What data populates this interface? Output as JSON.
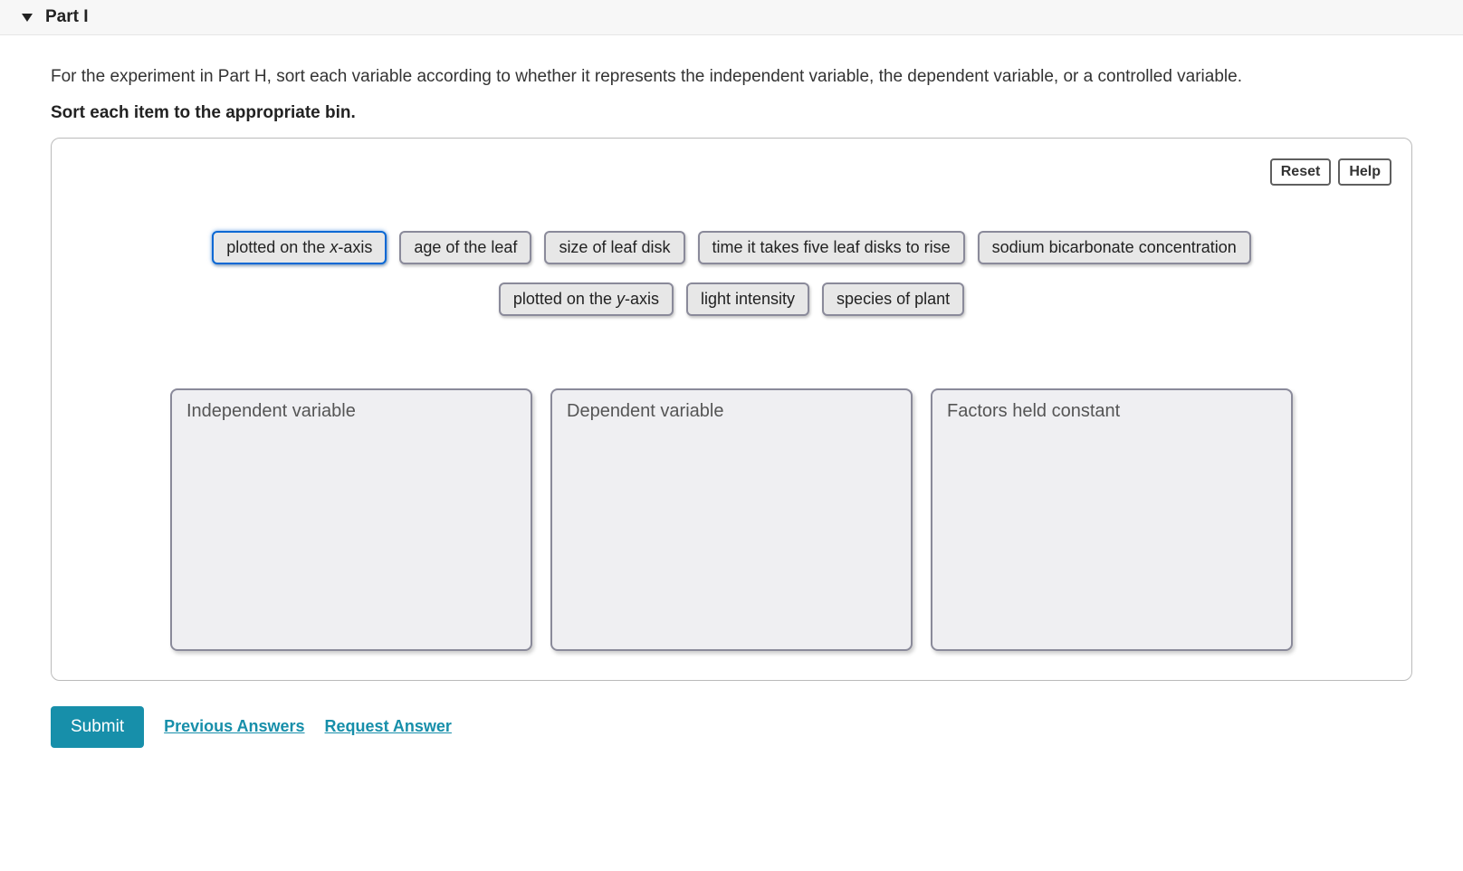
{
  "header": {
    "part_label": "Part I"
  },
  "prompt": {
    "line1": "For the experiment in Part H, sort each variable according to whether it represents the independent variable, the dependent variable, or a controlled variable.",
    "line2": "Sort each item to the appropriate bin."
  },
  "toolbar": {
    "reset_label": "Reset",
    "help_label": "Help"
  },
  "items": {
    "row1": {
      "i0_prefix": "plotted on the ",
      "i0_var": "x",
      "i0_suffix": "-axis",
      "i1": "age of the leaf",
      "i2": "size of leaf disk",
      "i3": "time it takes five leaf disks to rise",
      "i4": "sodium bicarbonate concentration"
    },
    "row2": {
      "i0_prefix": "plotted on the ",
      "i0_var": "y",
      "i0_suffix": "-axis",
      "i1": "light intensity",
      "i2": "species of plant"
    }
  },
  "bins": {
    "b0": "Independent variable",
    "b1": "Dependent variable",
    "b2": "Factors held constant"
  },
  "footer": {
    "submit_label": "Submit",
    "previous_answers_label": "Previous Answers",
    "request_answer_label": "Request Answer"
  }
}
